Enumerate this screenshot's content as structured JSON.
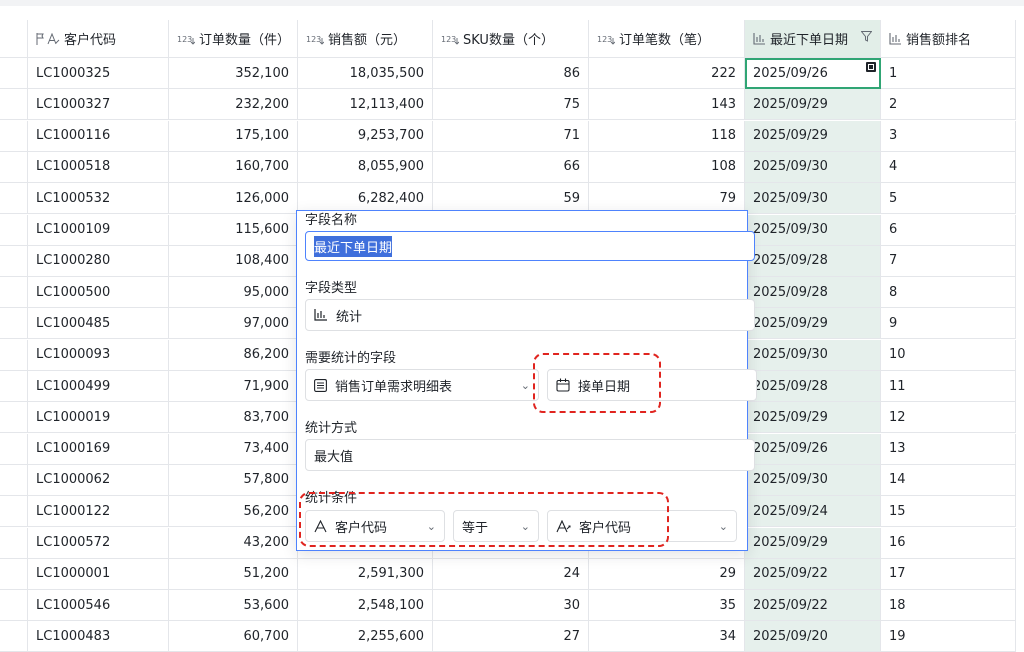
{
  "columns": [
    {
      "label": "客户代码",
      "icon": "text-icon"
    },
    {
      "label": "订单数量（件）",
      "icon": "number-icon"
    },
    {
      "label": "销售额（元）",
      "icon": "number-icon"
    },
    {
      "label": "SKU数量（个）",
      "icon": "number-icon"
    },
    {
      "label": "订单笔数（笔）",
      "icon": "number-icon"
    },
    {
      "label": "最近下单日期",
      "icon": "stats-icon"
    },
    {
      "label": "销售额排名",
      "icon": "stats-icon"
    }
  ],
  "rows": [
    {
      "code": "LC1000325",
      "qty": "352,100",
      "sales": "18,035,500",
      "sku": "86",
      "orders": "222",
      "date": "2025/09/26",
      "rank": "1"
    },
    {
      "code": "LC1000327",
      "qty": "232,200",
      "sales": "12,113,400",
      "sku": "75",
      "orders": "143",
      "date": "2025/09/29",
      "rank": "2"
    },
    {
      "code": "LC1000116",
      "qty": "175,100",
      "sales": "9,253,700",
      "sku": "71",
      "orders": "118",
      "date": "2025/09/29",
      "rank": "3"
    },
    {
      "code": "LC1000518",
      "qty": "160,700",
      "sales": "8,055,900",
      "sku": "66",
      "orders": "108",
      "date": "2025/09/30",
      "rank": "4"
    },
    {
      "code": "LC1000532",
      "qty": "126,000",
      "sales": "6,282,400",
      "sku": "59",
      "orders": "79",
      "date": "2025/09/30",
      "rank": "5"
    },
    {
      "code": "LC1000109",
      "qty": "115,600",
      "sales": "",
      "sku": "",
      "orders": "",
      "date": "2025/09/30",
      "rank": "6"
    },
    {
      "code": "LC1000280",
      "qty": "108,400",
      "sales": "",
      "sku": "",
      "orders": "",
      "date": "2025/09/28",
      "rank": "7"
    },
    {
      "code": "LC1000500",
      "qty": "95,000",
      "sales": "",
      "sku": "",
      "orders": "",
      "date": "2025/09/28",
      "rank": "8"
    },
    {
      "code": "LC1000485",
      "qty": "97,000",
      "sales": "",
      "sku": "",
      "orders": "",
      "date": "2025/09/29",
      "rank": "9"
    },
    {
      "code": "LC1000093",
      "qty": "86,200",
      "sales": "",
      "sku": "",
      "orders": "",
      "date": "2025/09/30",
      "rank": "10"
    },
    {
      "code": "LC1000499",
      "qty": "71,900",
      "sales": "",
      "sku": "",
      "orders": "",
      "date": "2025/09/28",
      "rank": "11"
    },
    {
      "code": "LC1000019",
      "qty": "83,700",
      "sales": "",
      "sku": "",
      "orders": "",
      "date": "2025/09/29",
      "rank": "12"
    },
    {
      "code": "LC1000169",
      "qty": "73,400",
      "sales": "",
      "sku": "",
      "orders": "",
      "date": "2025/09/26",
      "rank": "13"
    },
    {
      "code": "LC1000062",
      "qty": "57,800",
      "sales": "",
      "sku": "",
      "orders": "",
      "date": "2025/09/30",
      "rank": "14"
    },
    {
      "code": "LC1000122",
      "qty": "56,200",
      "sales": "",
      "sku": "",
      "orders": "",
      "date": "2025/09/24",
      "rank": "15"
    },
    {
      "code": "LC1000572",
      "qty": "43,200",
      "sales": "",
      "sku": "",
      "orders": "",
      "date": "2025/09/29",
      "rank": "16"
    },
    {
      "code": "LC1000001",
      "qty": "51,200",
      "sales": "2,591,300",
      "sku": "24",
      "orders": "29",
      "date": "2025/09/22",
      "rank": "17"
    },
    {
      "code": "LC1000546",
      "qty": "53,600",
      "sales": "2,548,100",
      "sku": "30",
      "orders": "35",
      "date": "2025/09/22",
      "rank": "18"
    },
    {
      "code": "LC1000483",
      "qty": "60,700",
      "sales": "2,255,600",
      "sku": "27",
      "orders": "34",
      "date": "2025/09/20",
      "rank": "19"
    }
  ],
  "popup": {
    "field_name_label": "字段名称",
    "field_name_value": "最近下单日期",
    "field_type_label": "字段类型",
    "field_type_value": "统计",
    "source_label": "需要统计的字段",
    "source_table": "销售订单需求明细表",
    "source_field": "接单日期",
    "method_label": "统计方式",
    "method_value": "最大值",
    "condition_label": "统计条件",
    "condition_field": "客户代码",
    "condition_operator": "等于",
    "condition_value": "客户代码"
  },
  "colors": {
    "accent_green": "#30a574",
    "selected_column_bg": "#e6f0ec",
    "popup_border": "#4e83fd",
    "highlight_dash": "#e0241f"
  }
}
